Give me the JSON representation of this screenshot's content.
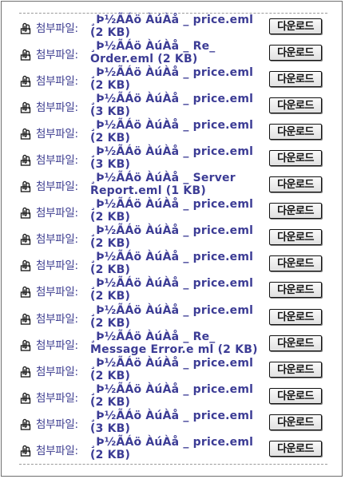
{
  "attachment_label": "첨부파일:",
  "download_label": "다운로드",
  "attachments": [
    {
      "file": "¸Þ½ÃÁö ÀúÀå _ price.eml (2 KB)"
    },
    {
      "file": "¸Þ½ÃÁö ÀúÀå _ Re_ Order.eml (2 KB)"
    },
    {
      "file": "¸Þ½ÃÁö ÀúÀå _ price.eml (2 KB)"
    },
    {
      "file": "¸Þ½ÃÁö ÀúÀå _ price.eml (3 KB)"
    },
    {
      "file": "¸Þ½ÃÁö ÀúÀå _ price.eml (2 KB)"
    },
    {
      "file": "¸Þ½ÃÁö ÀúÀå _ price.eml (3 KB)"
    },
    {
      "file": "¸Þ½ÃÁö ÀúÀå _ Server Report.eml (1 KB)"
    },
    {
      "file": "¸Þ½ÃÁö ÀúÀå _ price.eml (2 KB)"
    },
    {
      "file": "¸Þ½ÃÁö ÀúÀå _ price.eml (2 KB)"
    },
    {
      "file": "¸Þ½ÃÁö ÀúÀå _ price.eml (2 KB)"
    },
    {
      "file": "¸Þ½ÃÁö ÀúÀå _ price.eml (2 KB)"
    },
    {
      "file": "¸Þ½ÃÁö ÀúÀå _ price.eml (2 KB)"
    },
    {
      "file": "¸Þ½ÃÁö ÀúÀå _ Re_ Message Error.e ml (2 KB)"
    },
    {
      "file": "¸Þ½ÃÁö ÀúÀå _ price.eml (2 KB)"
    },
    {
      "file": "¸Þ½ÃÁö ÀúÀå _ price.eml (2 KB)"
    },
    {
      "file": "¸Þ½ÃÁö ÀúÀå _ price.eml (3 KB)"
    },
    {
      "file": "¸Þ½ÃÁö ÀúÀå _ price.eml (2 KB)"
    }
  ]
}
